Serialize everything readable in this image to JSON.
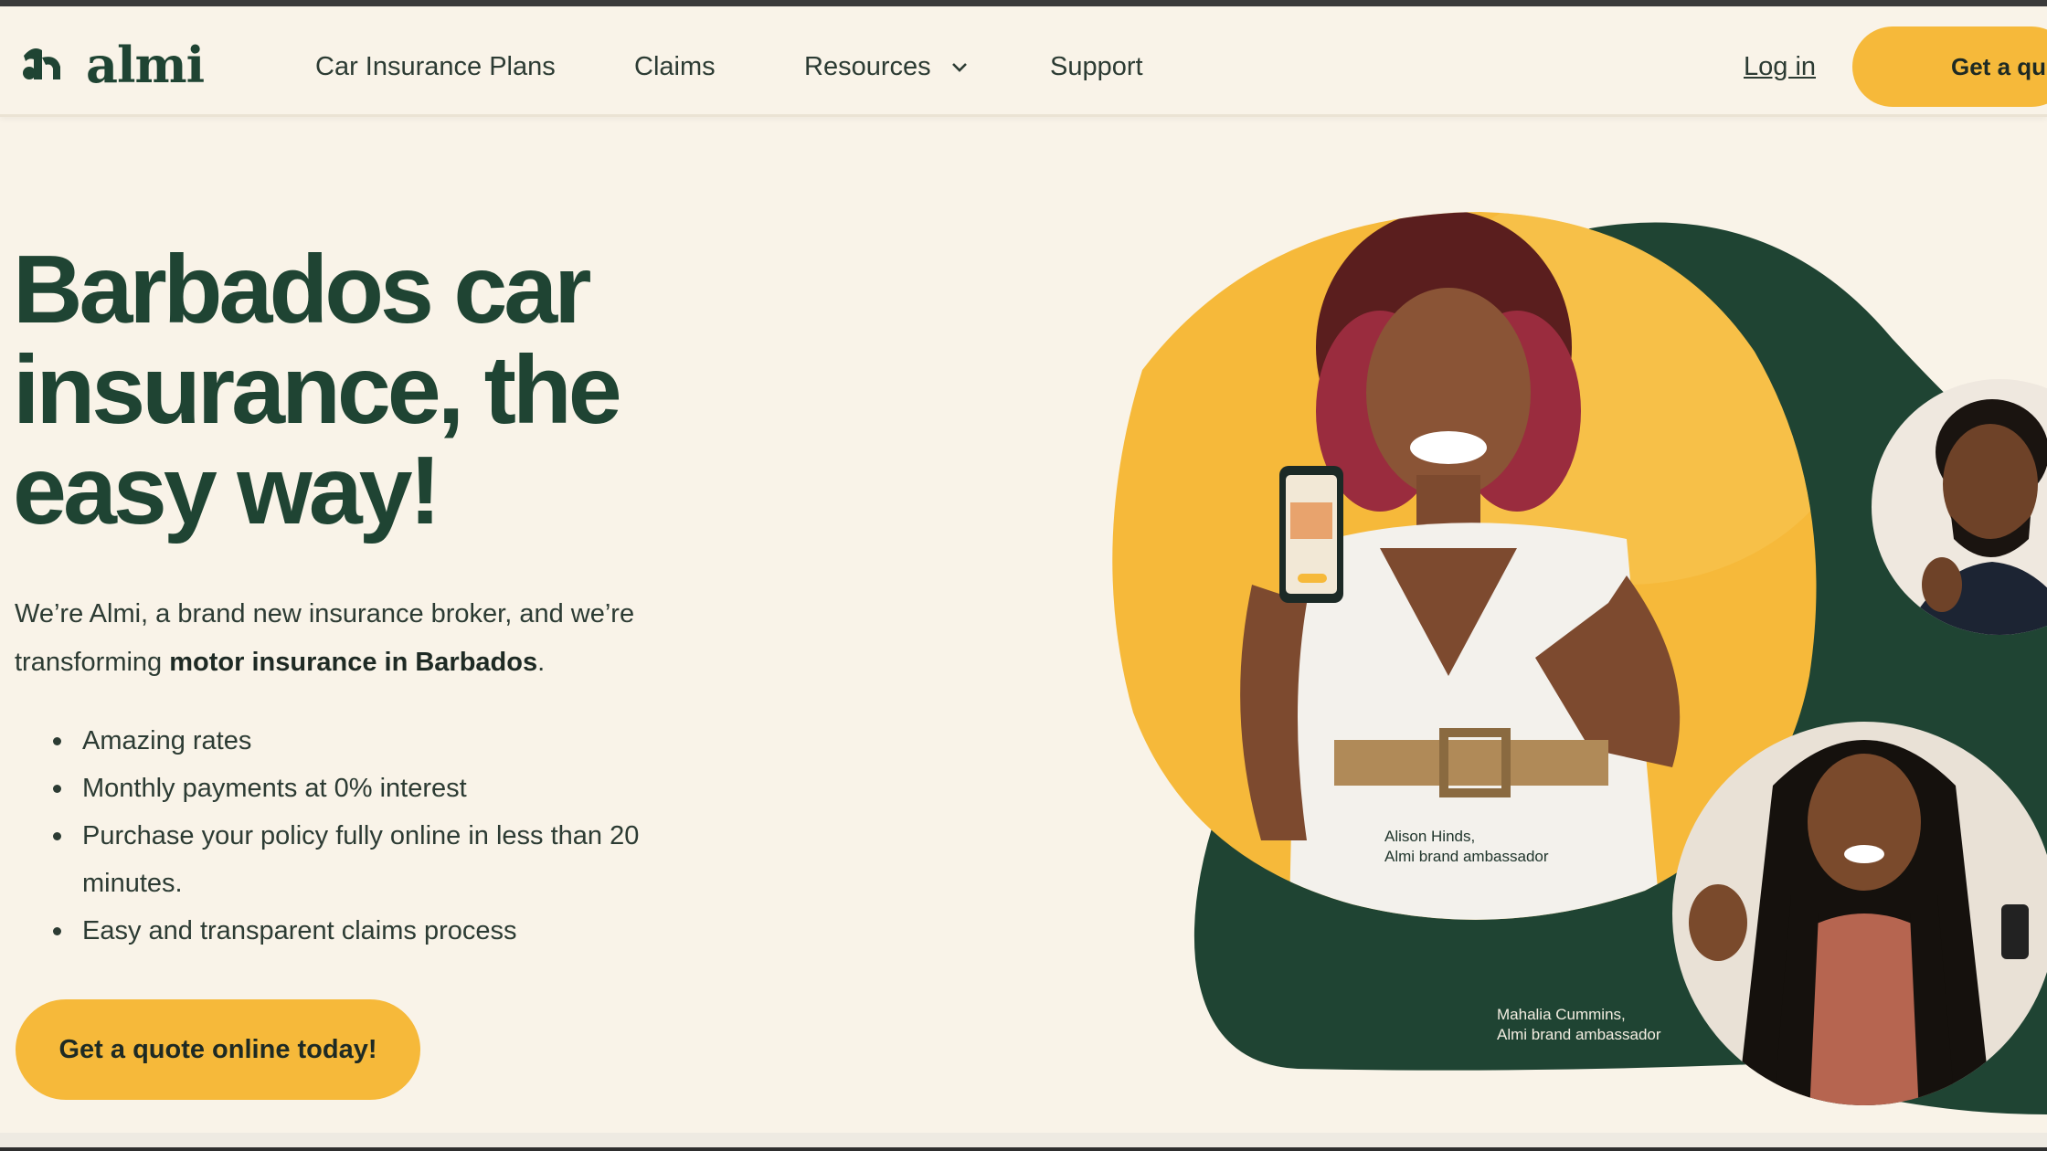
{
  "brand": {
    "name": "almi",
    "mark": "almi-logo-mark",
    "primary_green": "#1f4433",
    "accent_yellow": "#f6b93a",
    "background": "#f9f3e8"
  },
  "nav": {
    "links": [
      {
        "label": "Car Insurance Plans"
      },
      {
        "label": "Claims"
      },
      {
        "label": "Resources",
        "has_dropdown": true,
        "icon": "chevron-down-icon"
      },
      {
        "label": "Support"
      }
    ],
    "login_label": "Log in",
    "cta_label": "Get a quote"
  },
  "hero": {
    "headline": "Barbados car insurance, the easy way!",
    "intro_lead": "We’re Almi, a brand new insurance broker, and we’re transforming ",
    "intro_bold": "motor insurance in Barbados",
    "intro_tail": ".",
    "bullets": [
      "Amazing rates",
      "Monthly payments at 0% interest",
      "Purchase your policy fully online in less than 20 minutes.",
      "Easy and transparent claims process"
    ],
    "cta_label": "Get a quote online today!"
  },
  "photos": {
    "main_name": "Alison Hinds,",
    "main_role": "Almi brand ambassador",
    "second_name": "Mahalia Cummins,",
    "second_role": "Almi brand ambassador"
  }
}
